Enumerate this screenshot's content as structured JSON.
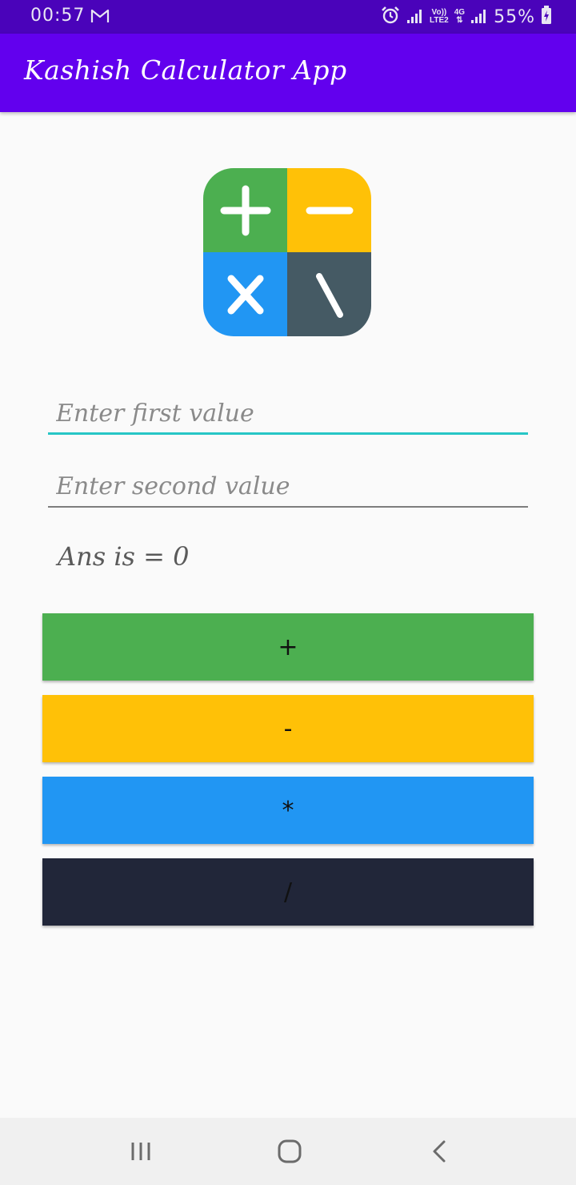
{
  "status_bar": {
    "time": "00:57",
    "mail_icon": "gmail-icon",
    "network_top": "Vo))",
    "network_bottom": "LTE2",
    "data_label": "4G",
    "battery": "55%"
  },
  "app_bar": {
    "title": "Kashish Calculator App"
  },
  "logo": {
    "icon": "calculator-logo-icon",
    "colors": {
      "plus": "#4caf50",
      "minus": "#ffc107",
      "multiply": "#2196f3",
      "divide": "#455a64"
    }
  },
  "inputs": {
    "first_placeholder": "Enter first value",
    "second_placeholder": "Enter second value"
  },
  "result": {
    "text": "Ans is = 0"
  },
  "buttons": {
    "add": "+",
    "subtract": "-",
    "multiply": "*",
    "divide": "/"
  },
  "colors": {
    "accent": "#03dac5",
    "primary": "#6200ee",
    "primary_dark": "#4a03ba",
    "add_button": "#4caf50",
    "subtract_button": "#ffc107",
    "multiply_button": "#2196f3",
    "divide_button": "#212639"
  },
  "nav_bar": {
    "recents_icon": "recents-icon",
    "home_icon": "home-icon",
    "back_icon": "back-icon"
  }
}
